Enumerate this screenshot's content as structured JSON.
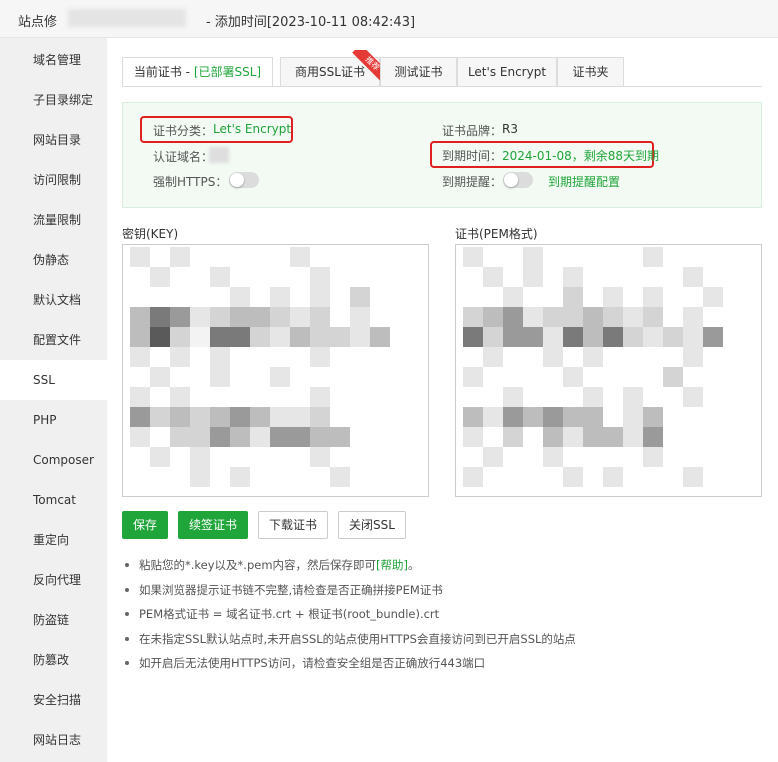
{
  "title": {
    "prefix": "站点修",
    "suffix": "- 添加时间[2023-10-11 08:42:43]"
  },
  "sidebar": {
    "items": [
      {
        "label": "域名管理"
      },
      {
        "label": "子目录绑定"
      },
      {
        "label": "网站目录"
      },
      {
        "label": "访问限制"
      },
      {
        "label": "流量限制"
      },
      {
        "label": "伪静态"
      },
      {
        "label": "默认文档"
      },
      {
        "label": "配置文件"
      },
      {
        "label": "SSL",
        "active": true
      },
      {
        "label": "PHP"
      },
      {
        "label": "Composer"
      },
      {
        "label": "Tomcat"
      },
      {
        "label": "重定向"
      },
      {
        "label": "反向代理"
      },
      {
        "label": "防盗链"
      },
      {
        "label": "防篡改"
      },
      {
        "label": "安全扫描"
      },
      {
        "label": "网站日志"
      }
    ]
  },
  "tabs": {
    "current": "当前证书 - ",
    "current_status": "[已部署SSL]",
    "commercial": "商用SSL证书",
    "commercial_badge": "推荐",
    "test": "测试证书",
    "letsencrypt": "Let's Encrypt",
    "folder": "证书夹"
  },
  "cert": {
    "category_label": "证书分类：",
    "category_value": "Let's Encrypt",
    "brand_label": "证书品牌：",
    "brand_value": "R3",
    "domain_label": "认证域名：",
    "expiry_label": "到期时间：",
    "expiry_value": "2024-01-08，剩余88天到期",
    "https_label": "强制HTTPS：",
    "https_enabled": false,
    "remind_label": "到期提醒：",
    "remind_enabled": false,
    "remind_link": "到期提醒配置"
  },
  "key_area": {
    "label": "密钥(KEY)"
  },
  "pem_area": {
    "label": "证书(PEM格式)"
  },
  "buttons": {
    "save": "保存",
    "renew": "续签证书",
    "download": "下载证书",
    "close_ssl": "关闭SSL"
  },
  "tips": {
    "t1_text": "粘贴您的*.key以及*.pem内容，然后保存即可",
    "t1_help": "[帮助]",
    "t1_end": "。",
    "t2": "如果浏览器提示证书链不完整,请检查是否正确拼接PEM证书",
    "t3": "PEM格式证书 = 域名证书.crt + 根证书(root_bundle).crt",
    "t4": "在未指定SSL默认站点时,未开启SSL的站点使用HTTPS会直接访问到已开启SSL的站点",
    "t5": "如开启后无法使用HTTPS访问，请检查安全组是否正确放行443端口"
  },
  "colors": {
    "brand_green": "#20a53a",
    "highlight_red": "#e02020",
    "sidebar_bg": "#f0f0f0"
  }
}
